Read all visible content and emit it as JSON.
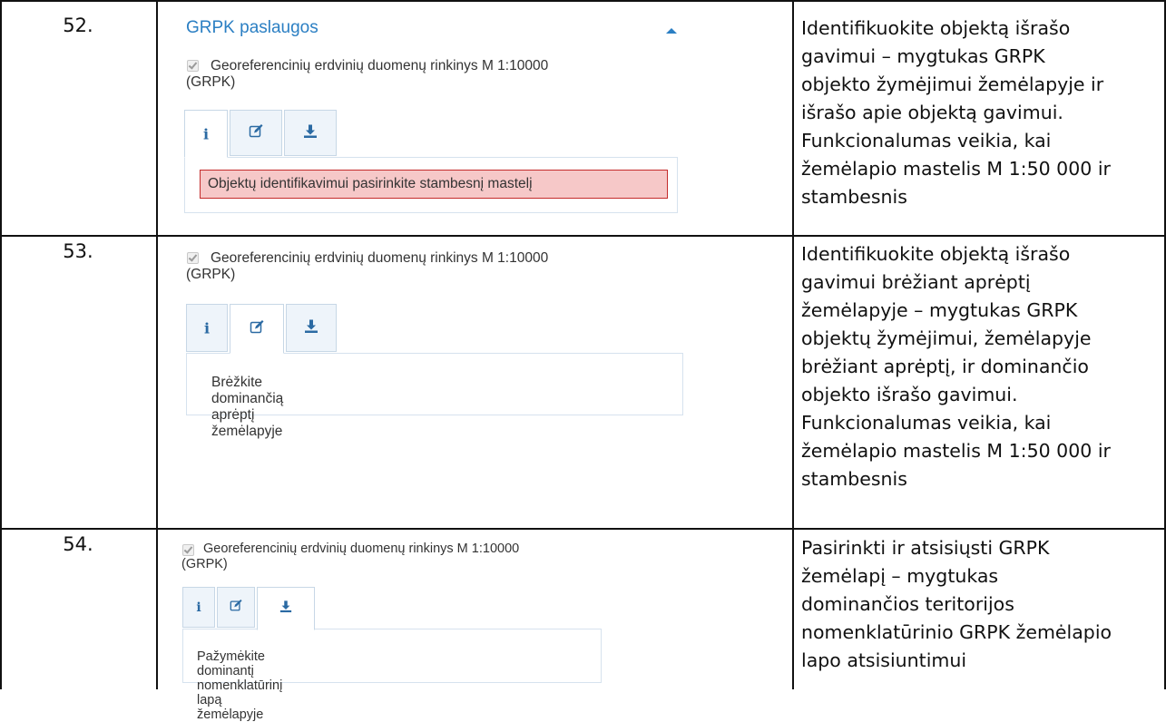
{
  "rows": [
    {
      "number": "52.",
      "panel_title": "GRPK paslaugos",
      "layer_line1": "Georeferencinių erdvinių duomenų rinkinys M 1:10000",
      "layer_line2": "(GRPK)",
      "active_tab": "info",
      "alert_text": "Objektų identifikavimui pasirinkite stambesnį mastelį",
      "description": [
        "Identifikuokite objektą išrašo",
        "gavimui – mygtukas GRPK",
        "objekto žymėjimui žemėlapyje ir",
        "išrašo apie objektą gavimui.",
        "Funkcionalumas veikia, kai",
        "žemėlapio mastelis M 1:50 000 ir",
        "stambesnis"
      ]
    },
    {
      "number": "53.",
      "layer_line1": "Georeferencinių erdvinių duomenų rinkinys M 1:10000",
      "layer_line2": "(GRPK)",
      "active_tab": "edit",
      "message": "Brėžkite dominančią aprėptį žemėlapyje",
      "description": [
        "Identifikuokite objektą išrašo",
        "gavimui brėžiant aprėptį",
        "žemėlapyje  – mygtukas GRPK",
        "objektų žymėjimui, žemėlapyje",
        "brėžiant aprėptį, ir dominančio",
        "objekto išrašo gavimui.",
        "Funkcionalumas veikia, kai",
        "žemėlapio mastelis M 1:50 000 ir",
        "stambesnis"
      ]
    },
    {
      "number": "54.",
      "layer_line1": "Georeferencinių erdvinių duomenų rinkinys M 1:10000",
      "layer_line2": "(GRPK)",
      "active_tab": "download",
      "message": "Pažymėkite dominantį nomenklatūrinį lapą žemėlapyje",
      "description": [
        "Pasirinkti ir atsisiųsti GRPK",
        "žemėlapį – mygtukas",
        "dominančios teritorijos",
        "nomenklatūrinio GRPK žemėlapio",
        "lapo atsisiuntimui"
      ]
    }
  ],
  "icons": {
    "info": "info-icon",
    "edit": "edit-icon",
    "download": "download-icon",
    "caret": "caret-up-icon",
    "checkbox": "checkbox-checked-icon"
  },
  "colors": {
    "link_blue": "#2b7fc3",
    "icon_blue": "#2b6aa3",
    "alert_bg": "#f6c8c8",
    "alert_border": "#c42b2b",
    "tab_border": "#c7d7e6"
  }
}
